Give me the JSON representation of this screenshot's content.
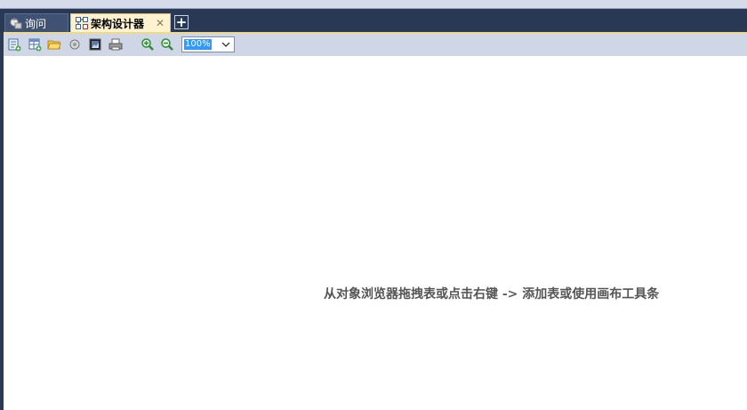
{
  "tabs": [
    {
      "label": "询问",
      "icon": "query-icon",
      "active": false
    },
    {
      "label": "架构设计器",
      "icon": "schema-designer-icon",
      "active": true
    }
  ],
  "tab_close_glyph": "✕",
  "tab_add_glyph": "+",
  "toolbar": {
    "buttons": [
      "new-icon",
      "add-table-icon",
      "open-folder-icon",
      "refresh-icon",
      "export-image-icon",
      "print-icon",
      "zoom-in-icon",
      "zoom-out-icon"
    ],
    "zoom": {
      "value": "100%"
    }
  },
  "canvas": {
    "hint": "从对象浏览器拖拽表或点击右键 -> 添加表或使用画布工具条"
  },
  "colors": {
    "frame": "#293955",
    "active_tab": "#fff2cf",
    "toolbar": "#cfd6e5",
    "canvas": "#ffffff"
  }
}
